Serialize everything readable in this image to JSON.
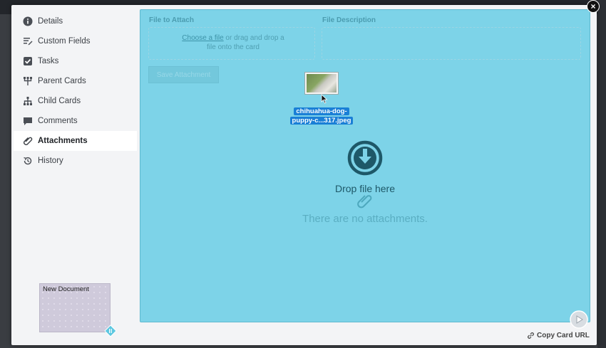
{
  "sidebar": {
    "items": [
      {
        "label": "Details",
        "icon": "info-icon"
      },
      {
        "label": "Custom Fields",
        "icon": "custom-fields-icon"
      },
      {
        "label": "Tasks",
        "icon": "checkbox-icon"
      },
      {
        "label": "Parent Cards",
        "icon": "parent-cards-icon"
      },
      {
        "label": "Child Cards",
        "icon": "child-cards-icon"
      },
      {
        "label": "Comments",
        "icon": "comment-icon"
      },
      {
        "label": "Attachments",
        "icon": "paperclip-icon"
      },
      {
        "label": "History",
        "icon": "history-icon"
      }
    ],
    "active": "Attachments"
  },
  "document_card": {
    "title": "New Document"
  },
  "attach_form": {
    "file_label": "File to Attach",
    "description_label": "File Description",
    "choose_link": "Choose a file",
    "choose_rest_line1": " or drag and drop a",
    "choose_rest_line2": "file onto the card",
    "save_label": "Save Attachment"
  },
  "dragged_file": {
    "line1": "chihuahua-dog-",
    "line2": "puppy-c...317.jpeg"
  },
  "drop": {
    "text": "Drop file here",
    "empty_text": "There are no attachments."
  },
  "footer": {
    "copy_url": "Copy Card URL"
  },
  "close_symbol": "×",
  "colors": {
    "dropzone": "#7dd3e8",
    "accent_dark": "#1e5868",
    "drag_label": "#1a7fd6"
  }
}
